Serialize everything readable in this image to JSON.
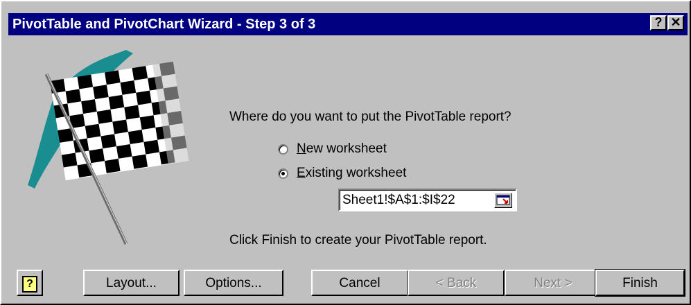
{
  "window": {
    "title": "PivotTable and PivotChart Wizard - Step 3 of 3",
    "help_caption": "?",
    "close_caption": "✕"
  },
  "main": {
    "prompt": "Where do you want to put the PivotTable report?",
    "options": [
      {
        "label": "New worksheet",
        "mnemonic": "N",
        "rest": "ew worksheet",
        "selected": false
      },
      {
        "label": "Existing worksheet",
        "mnemonic": "E",
        "rest": "xisting worksheet",
        "selected": true
      }
    ],
    "range_value": "Sheet1!$A$1:$I$22",
    "finish_note": "Click Finish to create your PivotTable report."
  },
  "buttons": {
    "help": "?",
    "layout": "Layout...",
    "options": "Options...",
    "cancel": "Cancel",
    "back": "< Back",
    "next": "Next >",
    "finish": "Finish"
  },
  "colors": {
    "titlebar": "#000080",
    "face": "#c0c0c0",
    "flag_accent": "#0f8b8d"
  },
  "icons": {
    "flag": "checkered-flag-icon",
    "collapse": "collapse-dialog-icon",
    "help": "help-icon"
  }
}
